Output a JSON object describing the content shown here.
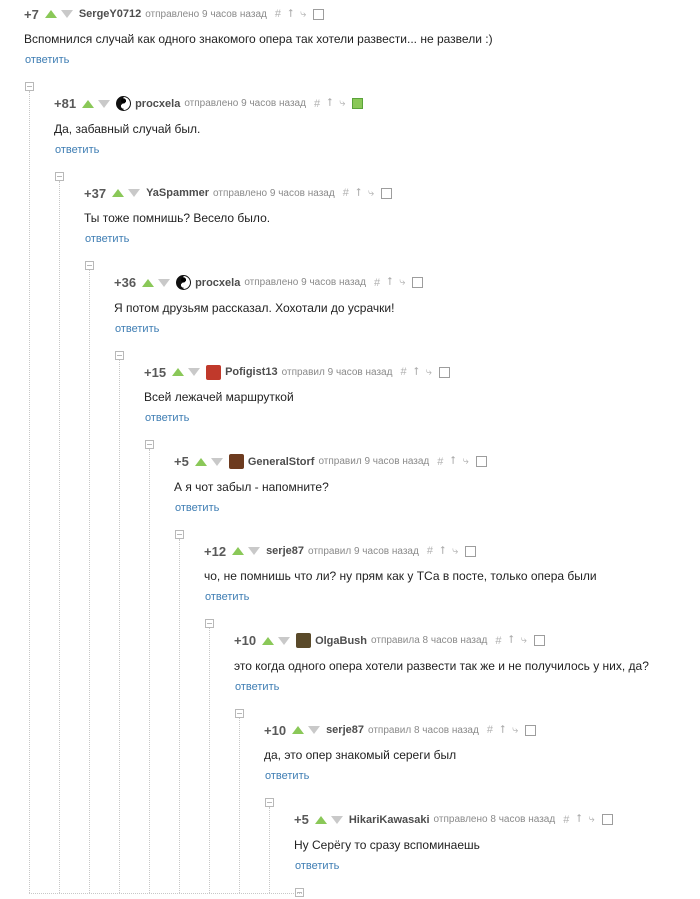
{
  "icons": {
    "link": "#",
    "up": "⭡",
    "tree": "⤷"
  },
  "comments": [
    {
      "rating": "+7",
      "user": "SergeY0712",
      "time": "отправлено 9 часов назад",
      "text": "Вспомнился случай как одного знакомого опера так хотели развести... не развели :)",
      "reply": "ответить",
      "avatar": "none"
    },
    {
      "rating": "+81",
      "user": "procxela",
      "time": "отправлено 9 часов назад",
      "text": "Да, забавный случай был.",
      "reply": "ответить",
      "avatar": "yinyang"
    },
    {
      "rating": "+37",
      "user": "YaSpammer",
      "time": "отправлено 9 часов назад",
      "text": "Ты тоже помнишь? Весело было.",
      "reply": "ответить",
      "avatar": "none"
    },
    {
      "rating": "+36",
      "user": "procxela",
      "time": "отправлено 9 часов назад",
      "text": "Я потом друзьям рассказал. Хохотали до усрачки!",
      "reply": "ответить",
      "avatar": "yinyang"
    },
    {
      "rating": "+15",
      "user": "Pofigist13",
      "time": "отправил 9 часов назад",
      "text": "Всей лежачей маршруткой",
      "reply": "ответить",
      "avatar": "red"
    },
    {
      "rating": "+5",
      "user": "GeneralStorf",
      "time": "отправил 9 часов назад",
      "text": "А я чот забыл - напомните?",
      "reply": "ответить",
      "avatar": "brown"
    },
    {
      "rating": "+12",
      "user": "serje87",
      "time": "отправил 9 часов назад",
      "text": "чо, не помнишь что ли? ну прям как у ТСа в посте, только опера были",
      "reply": "ответить",
      "avatar": "none"
    },
    {
      "rating": "+10",
      "user": "OlgaBush",
      "time": "отправила 8 часов назад",
      "text": "это когда одного опера хотели развести так же и не получилось у них, да?",
      "reply": "ответить",
      "avatar": "dark"
    },
    {
      "rating": "+10",
      "user": "serje87",
      "time": "отправил 8 часов назад",
      "text": "да, это опер знакомый сереги был",
      "reply": "ответить",
      "avatar": "none"
    },
    {
      "rating": "+5",
      "user": "HikariKawasaki",
      "time": "отправлено 8 часов назад",
      "text": "Ну Серёгу то сразу вспоминаешь",
      "reply": "ответить",
      "avatar": "none"
    }
  ]
}
